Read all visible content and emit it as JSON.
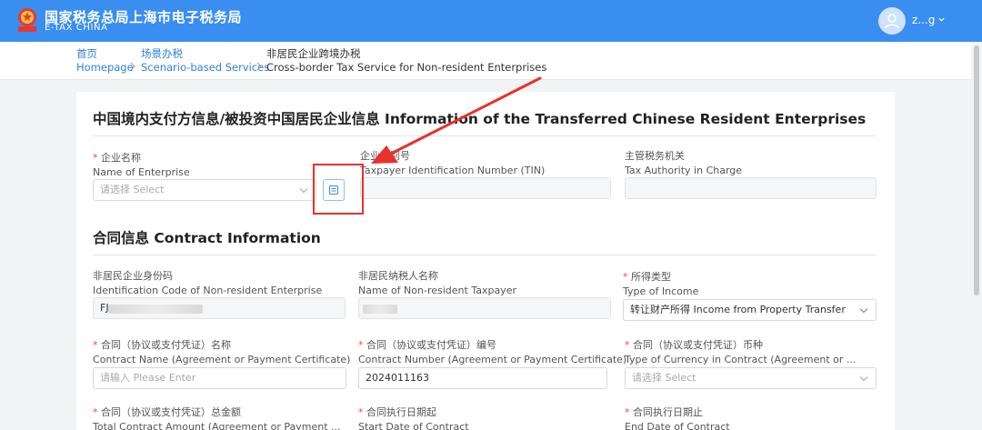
{
  "header": {
    "title": "国家税务总局上海市电子税务局",
    "subtitle": "E-TAX CHINA",
    "user_name": "z...g"
  },
  "breadcrumb": [
    {
      "cn": "首页",
      "en": "Homepage"
    },
    {
      "cn": "场景办税",
      "en": "Scenario-based Services"
    },
    {
      "cn": "非居民企业跨境办税",
      "en": "Cross-border Tax Service for Non-resident Enterprises"
    }
  ],
  "section1": {
    "title": "中国境内支付方信息/被投资中国居民企业信息 Information of the Transferred Chinese Resident Enterprises",
    "enterprise": {
      "required": "*",
      "label_cn": "企业名称",
      "label_en": "Name of Enterprise",
      "placeholder": "请选择 Select"
    },
    "tin": {
      "label_cn": "企业识别号",
      "label_en": "Taxpayer Identification Number (TIN)",
      "value": ""
    },
    "authority": {
      "label_cn": "主管税务机关",
      "label_en": "Tax Authority in Charge",
      "value": ""
    }
  },
  "section2": {
    "title": "合同信息 Contract Information",
    "id_code": {
      "label_cn": "非居民企业身份码",
      "label_en": "Identification Code of Non-resident Enterprise",
      "value": "FJ"
    },
    "taxpayer_name": {
      "label_cn": "非居民纳税人名称",
      "label_en": "Name of Non-resident Taxpayer",
      "value": ""
    },
    "income_type": {
      "required": "*",
      "label_cn": "所得类型",
      "label_en": "Type of Income",
      "value": "转让财产所得 Income from Property Transfer"
    },
    "contract_name": {
      "required": "*",
      "label_cn": "合同（协议或支付凭证）名称",
      "label_en": "Contract Name (Agreement or Payment Certificate)",
      "placeholder": "请输入 Please Enter"
    },
    "contract_number": {
      "required": "*",
      "label_cn": "合同（协议或支付凭证）编号",
      "label_en": "Contract Number (Agreement or Payment Certificate)",
      "value": "2024011163"
    },
    "currency": {
      "required": "*",
      "label_cn": "合同（协议或支付凭证）币种",
      "label_en": "Type of Currency in Contract (Agreement or ...",
      "placeholder": "请选择 Select"
    },
    "total_amount": {
      "required": "*",
      "label_cn": "合同（协议或支付凭证）总金额",
      "label_en": "Total Contract Amount (Agreement or Payment ..."
    },
    "start_date": {
      "required": "*",
      "label_cn": "合同执行日期起",
      "label_en": "Start Date of Contract"
    },
    "end_date": {
      "required": "*",
      "label_cn": "合同执行日期止",
      "label_en": "End Date of Contract"
    }
  },
  "colors": {
    "brand": "#3a8ef0",
    "link": "#2f7fe5",
    "annotation": "#e8312a",
    "required": "#e5484d"
  },
  "icons": [
    "national-emblem-icon",
    "user-avatar-icon",
    "chevron-down-icon",
    "chevron-right-icon",
    "select-list-icon"
  ]
}
